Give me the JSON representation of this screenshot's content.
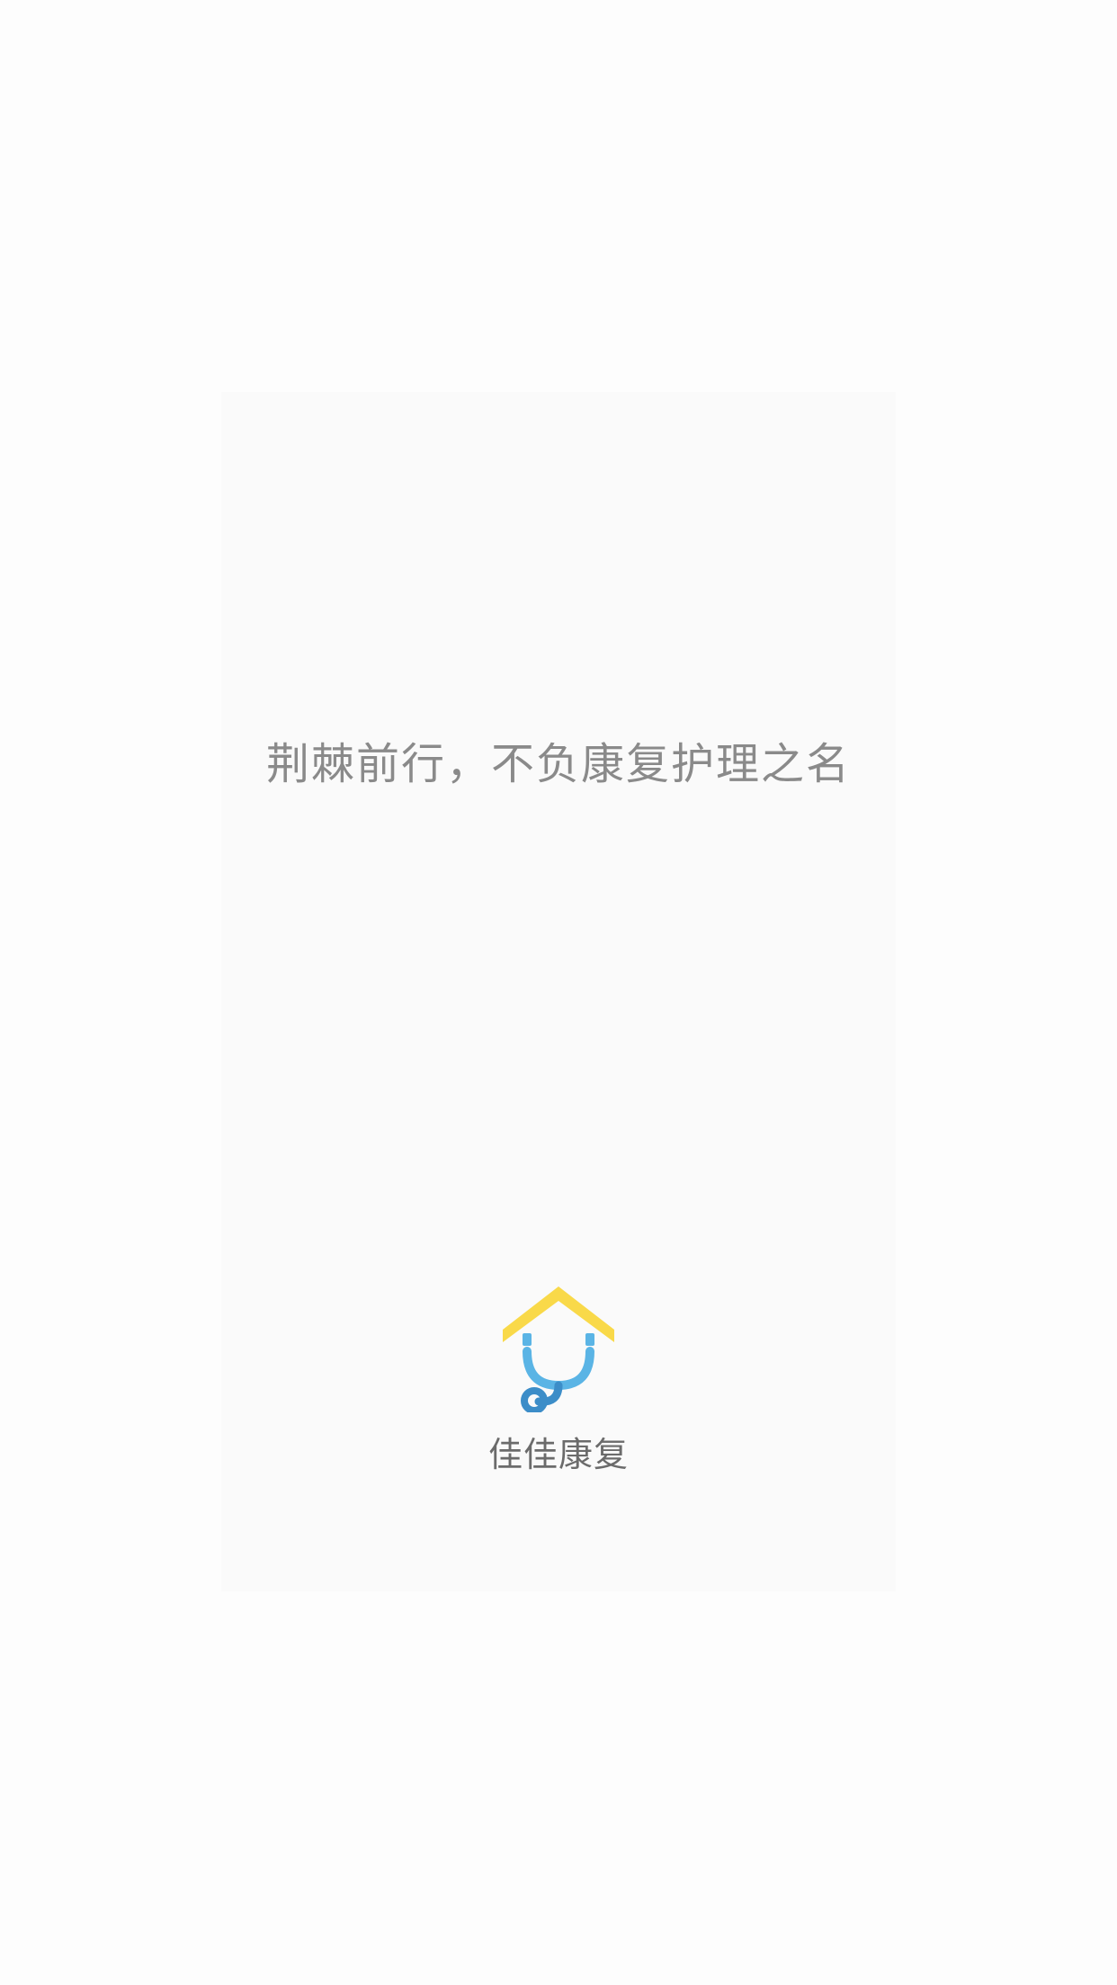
{
  "splash": {
    "slogan": "荆棘前行，不负康复护理之名",
    "brand_name": "佳佳康复"
  },
  "logo": {
    "icon": "house-stethoscope-icon",
    "roof_color": "#F9D949",
    "stethoscope_light_color": "#5AB4E5",
    "stethoscope_dark_color": "#3C8DC8"
  }
}
